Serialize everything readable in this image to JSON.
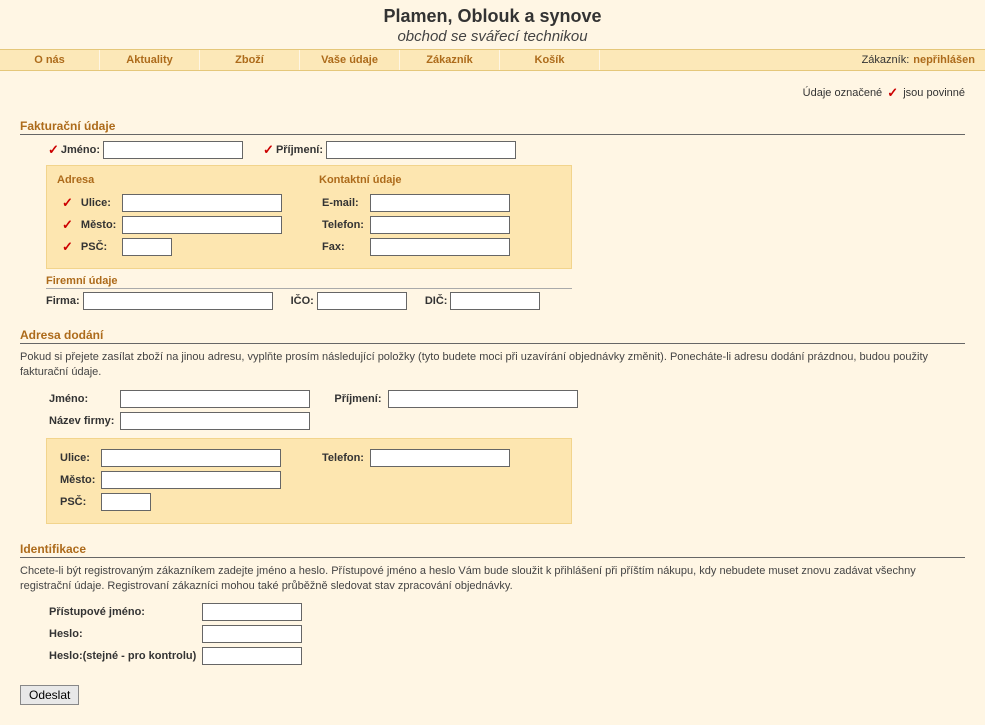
{
  "header": {
    "title": "Plamen, Oblouk a synove",
    "subtitle": "obchod se svářecí technikou"
  },
  "nav": {
    "items": [
      "O nás",
      "Aktuality",
      "Zboží",
      "Vaše údaje",
      "Zákazník",
      "Košík"
    ],
    "status_label": "Zákazník:",
    "status_value": "nepřihlášen"
  },
  "required_note": {
    "before": "Údaje označené",
    "after": "jsou povinné"
  },
  "billing": {
    "title": "Fakturační údaje",
    "first_name": "Jméno:",
    "last_name": "Příjmení:",
    "address_box_title": "Adresa",
    "street": "Ulice:",
    "city": "Město:",
    "zip": "PSČ:",
    "contact_box_title": "Kontaktní údaje",
    "email": "E-mail:",
    "phone": "Telefon:",
    "fax": "Fax:",
    "company_title": "Firemní údaje",
    "company": "Firma:",
    "ico": "IČO:",
    "dic": "DIČ:"
  },
  "shipping": {
    "title": "Adresa dodání",
    "desc": "Pokud si přejete zasílat zboží na jinou adresu, vyplňte prosím následující položky (tyto budete moci při uzavírání objednávky změnit). Ponecháte-li adresu dodání prázdnou, budou použity fakturační údaje.",
    "first_name": "Jméno:",
    "last_name": "Příjmení:",
    "company_name": "Název firmy:",
    "street": "Ulice:",
    "city": "Město:",
    "zip": "PSČ:",
    "phone": "Telefon:"
  },
  "ident": {
    "title": "Identifikace",
    "desc": "Chcete-li být registrovaným zákazníkem zadejte jméno a heslo. Přístupové jméno a heslo Vám bude sloužit k přihlášení při příštím nákupu, kdy nebudete muset znovu zadávat všechny registrační údaje. Registrovaní zákazníci mohou také průběžně sledovat stav zpracování objednávky.",
    "login": "Přístupové jméno:",
    "password": "Heslo:",
    "password2": "Heslo:(stejné - pro kontrolu)"
  },
  "submit": "Odeslat"
}
